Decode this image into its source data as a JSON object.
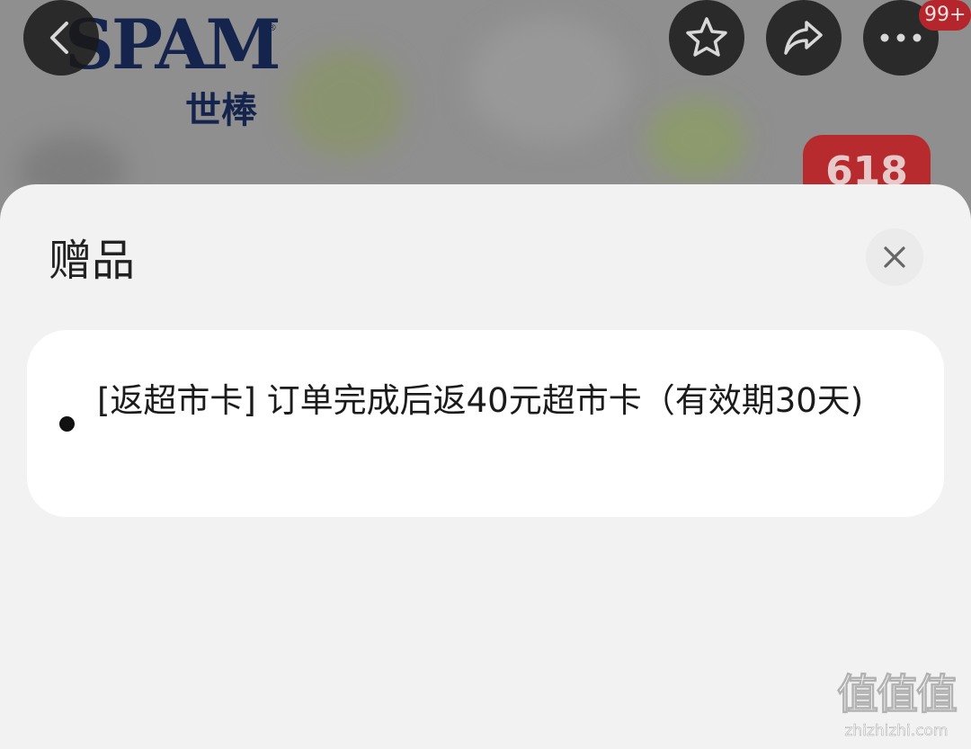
{
  "header": {
    "brand_logo": "SPAM",
    "brand_logo_sub": "世棒",
    "brand_logo_mark": "®",
    "notification_badge": "99+",
    "promo_tag": "618",
    "icons": {
      "back": "chevron-left-icon",
      "favorite": "star-icon",
      "share": "share-arrow-icon",
      "more": "more-dots-icon"
    }
  },
  "sheet": {
    "title": "赠品",
    "close_icon": "close-icon",
    "gifts": [
      {
        "text": "[返超市卡] 订单完成后返40元超市卡（有效期30天)"
      }
    ]
  },
  "watermark": {
    "logo": "值值值",
    "url": "zhizhizhi.com"
  },
  "colors": {
    "sheet_bg": "#f2f2f2",
    "card_bg": "#ffffff",
    "badge_red": "#b5262c",
    "brand_navy": "#14244d",
    "text_dark": "#222222"
  }
}
